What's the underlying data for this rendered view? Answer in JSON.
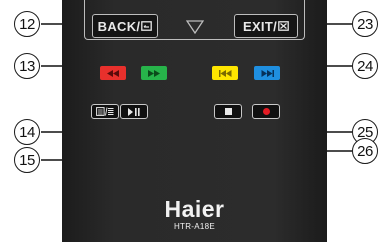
{
  "remote": {
    "back_label": "BACK/",
    "exit_label": "EXIT/",
    "brand": "Haier",
    "model": "HTR-A18E"
  },
  "callouts": [
    "12",
    "13",
    "14",
    "15",
    "23",
    "24",
    "25",
    "26"
  ],
  "colors": {
    "red": "#e8302c",
    "green": "#27b34a",
    "yellow": "#ffe600",
    "blue": "#1f8fe0",
    "record_dot": "#e31b23"
  },
  "icons": [
    "rewind-icon",
    "fast-forward-icon",
    "skip-back-icon",
    "skip-forward-icon",
    "text-mode-icon",
    "play-pause-icon",
    "stop-icon",
    "record-icon",
    "down-arrow-icon",
    "back-return-icon",
    "exit-close-icon"
  ]
}
